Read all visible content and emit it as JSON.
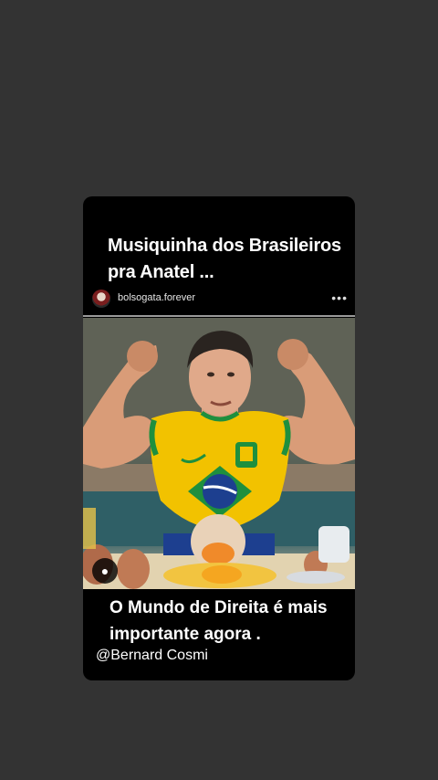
{
  "story": {
    "title": "Musiquinha dos Brasileiros pra Anatel ...",
    "post": {
      "username": "bolsogata.forever",
      "more_icon": "more-horizontal-icon",
      "tag_icon": "person-tag-icon"
    },
    "caption": "O Mundo de Direita é mais importante agora .",
    "credit": "@Bernard Cosmi"
  },
  "colors": {
    "background": "#333333",
    "card": "#000000",
    "jersey_yellow": "#f2c200",
    "jersey_green": "#1e8f3e",
    "flag_blue": "#1d3f8f"
  }
}
